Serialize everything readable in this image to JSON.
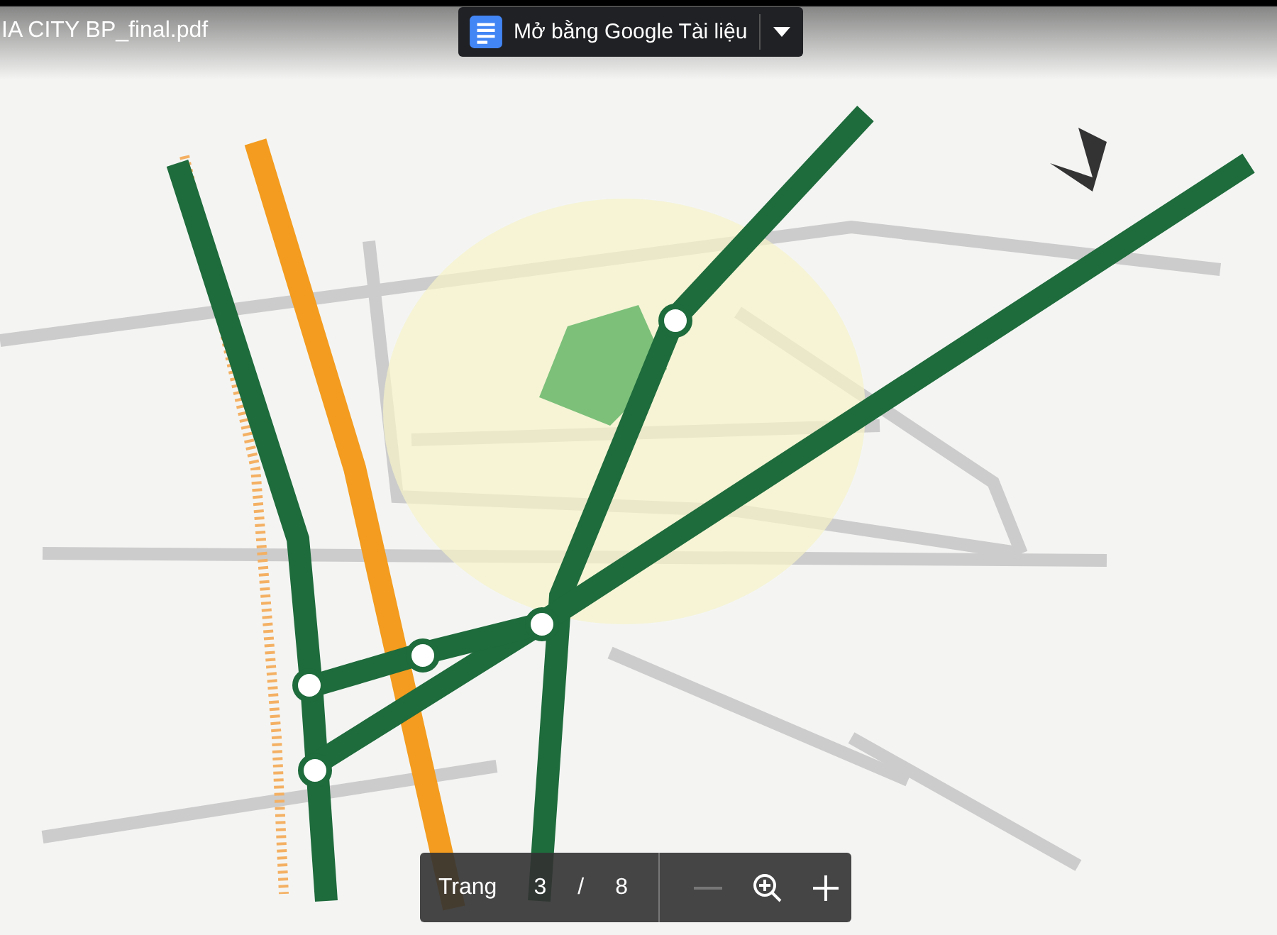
{
  "header": {
    "file_name": "IA CITY BP_final.pdf",
    "open_with": "Mở bằng Google Tài liệu"
  },
  "page_control": {
    "label": "Trang",
    "current": "3",
    "separator": "/",
    "total": "8",
    "zoom_out_disabled": true
  }
}
